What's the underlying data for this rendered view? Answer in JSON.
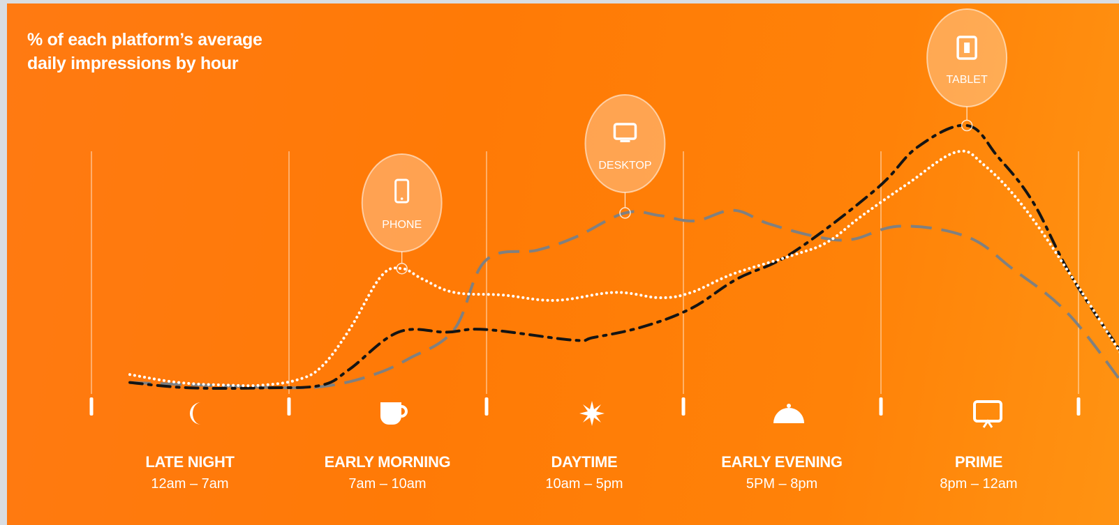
{
  "chart_data": {
    "type": "line",
    "title": "% of each platform’s average daily impressions by hour",
    "title_lines": [
      "% of each platform’s average",
      "daily impressions by hour"
    ],
    "x_domain": [
      0,
      24
    ],
    "y_domain": [
      0,
      1
    ],
    "grid_hours": [
      0,
      7,
      10,
      17,
      20,
      24
    ],
    "periods": [
      {
        "name": "LATE NIGHT",
        "range": "12am – 7am",
        "icon": "moon-icon",
        "start": 0,
        "end": 7
      },
      {
        "name": "EARLY MORNING",
        "range": "7am – 10am",
        "icon": "coffee-cup-icon",
        "start": 7,
        "end": 10
      },
      {
        "name": "DAYTIME",
        "range": "10am – 5pm",
        "icon": "sun-icon",
        "start": 10,
        "end": 17
      },
      {
        "name": "EARLY EVENING",
        "range": "5PM – 8pm",
        "icon": "cloche-icon",
        "start": 17,
        "end": 20
      },
      {
        "name": "PRIME",
        "range": "8pm – 12am",
        "icon": "tv-icon",
        "start": 20,
        "end": 24
      }
    ],
    "series": [
      {
        "name": "PHONE",
        "style": "dotted",
        "color": "#ffffff",
        "icon": "phone-icon",
        "peak": {
          "hour": 8.9,
          "value": 0.46
        },
        "points": [
          [
            1.1,
            0.06
          ],
          [
            2.5,
            0.03
          ],
          [
            3.9,
            0.02
          ],
          [
            4.9,
            0.02
          ],
          [
            5.9,
            0.04
          ],
          [
            6.6,
            0.09
          ],
          [
            7.4,
            0.23
          ],
          [
            8.3,
            0.43
          ],
          [
            8.9,
            0.46
          ],
          [
            9.5,
            0.42
          ],
          [
            10.4,
            0.37
          ],
          [
            11.8,
            0.36
          ],
          [
            13.3,
            0.34
          ],
          [
            15,
            0.37
          ],
          [
            16.3,
            0.35
          ],
          [
            17.2,
            0.37
          ],
          [
            18.4,
            0.44
          ],
          [
            20.1,
            0.51
          ],
          [
            21.1,
            0.56
          ],
          [
            22.1,
            0.66
          ],
          [
            23.4,
            0.78
          ],
          [
            24.8,
            0.9
          ],
          [
            25.6,
            0.85
          ],
          [
            26.8,
            0.68
          ],
          [
            28.3,
            0.39
          ],
          [
            29.7,
            0.1
          ]
        ]
      },
      {
        "name": "DESKTOP",
        "style": "dashed",
        "color": "#808080",
        "icon": "desktop-icon",
        "peak": {
          "hour": 15.3,
          "value": 0.67
        },
        "points": [
          [
            1.1,
            0.03
          ],
          [
            3.2,
            0.02
          ],
          [
            5.7,
            0.01
          ],
          [
            6.9,
            0.02
          ],
          [
            8.1,
            0.06
          ],
          [
            9.1,
            0.12
          ],
          [
            10.4,
            0.23
          ],
          [
            11.3,
            0.49
          ],
          [
            12.8,
            0.53
          ],
          [
            13.9,
            0.58
          ],
          [
            15.3,
            0.67
          ],
          [
            16.3,
            0.66
          ],
          [
            17.3,
            0.64
          ],
          [
            18.4,
            0.68
          ],
          [
            19.4,
            0.63
          ],
          [
            20.8,
            0.58
          ],
          [
            21.8,
            0.57
          ],
          [
            23.2,
            0.62
          ],
          [
            25.1,
            0.58
          ],
          [
            26.4,
            0.46
          ],
          [
            28,
            0.29
          ],
          [
            29.6,
            0.02
          ]
        ]
      },
      {
        "name": "TABLET",
        "style": "dash-dot",
        "color": "#141414",
        "icon": "tablet-icon",
        "peak": {
          "hour": 25.1,
          "value": 1.0
        },
        "points": [
          [
            1.1,
            0.03
          ],
          [
            2.8,
            0.01
          ],
          [
            5.1,
            0.01
          ],
          [
            6.6,
            0.02
          ],
          [
            7.4,
            0.08
          ],
          [
            8.8,
            0.22
          ],
          [
            10.2,
            0.22
          ],
          [
            11.3,
            0.23
          ],
          [
            13.8,
            0.19
          ],
          [
            14.4,
            0.2
          ],
          [
            15.8,
            0.24
          ],
          [
            17.2,
            0.31
          ],
          [
            18.5,
            0.42
          ],
          [
            20.1,
            0.52
          ],
          [
            22.5,
            0.76
          ],
          [
            23.7,
            0.92
          ],
          [
            25.1,
            1.0
          ],
          [
            26,
            0.88
          ],
          [
            27,
            0.71
          ],
          [
            28.1,
            0.43
          ],
          [
            29.7,
            0.11
          ]
        ]
      }
    ]
  }
}
